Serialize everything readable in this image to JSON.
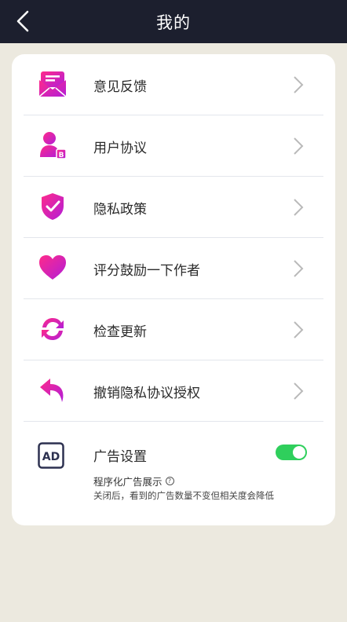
{
  "header": {
    "title": "我的",
    "back_icon": "chevron-left-icon"
  },
  "menu": {
    "items": [
      {
        "label": "意见反馈",
        "icon": "mail-feedback-icon"
      },
      {
        "label": "用户协议",
        "icon": "user-agreement-icon"
      },
      {
        "label": "隐私政策",
        "icon": "shield-check-icon"
      },
      {
        "label": "评分鼓励一下作者",
        "icon": "heart-icon"
      },
      {
        "label": "检查更新",
        "icon": "refresh-icon"
      },
      {
        "label": "撤销隐私协议授权",
        "icon": "undo-arrow-icon"
      }
    ]
  },
  "ad_settings": {
    "icon_text": "AD",
    "title": "广告设置",
    "toggle_on": true,
    "subtitle": "程序化广告展示",
    "help_glyph": "?",
    "note": "关闭后，看到的广告数量不变但相关度会降低"
  },
  "colors": {
    "nav_bg": "#1c1f2e",
    "page_bg": "#ece9df",
    "icon_gradient_start": "#ff2a8a",
    "icon_gradient_end": "#b21ed8",
    "toggle_on": "#2fcf5c"
  }
}
